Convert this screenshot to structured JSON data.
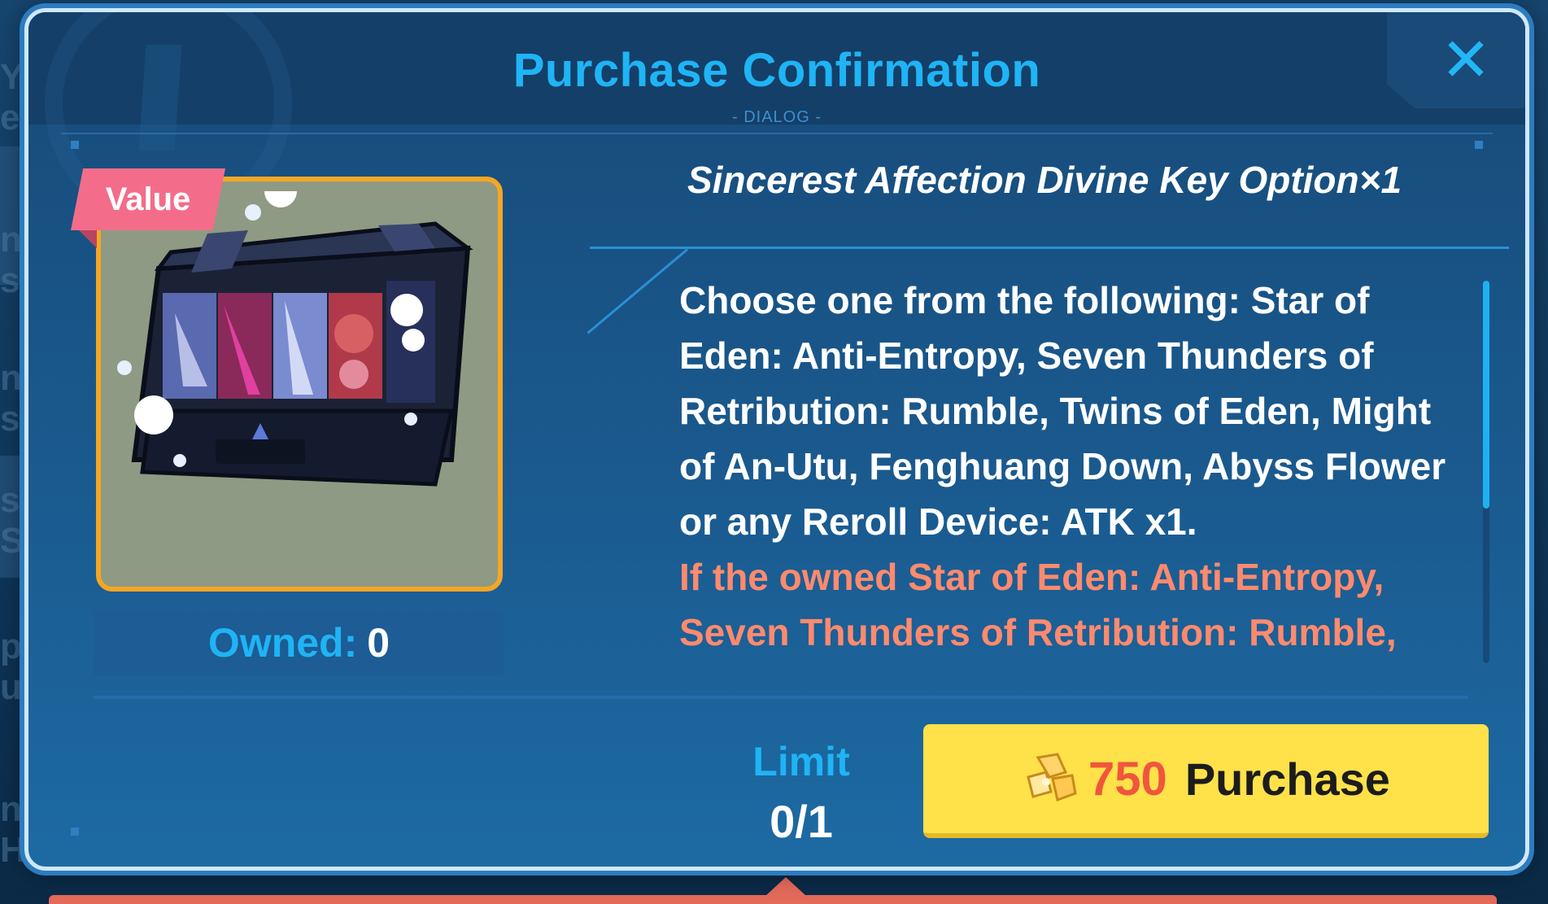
{
  "background_fragments": [
    "Yo",
    "ear",
    "nh",
    "sur",
    "nh",
    "sur",
    "sh",
    "Sh",
    "pe",
    "us",
    "nt",
    "Ho"
  ],
  "dialog": {
    "title": "Purchase Confirmation",
    "subtitle": "- DIALOG -",
    "close_icon": "close-icon"
  },
  "item": {
    "tag": "Value",
    "image_icon": "treasure-chest-icon",
    "owned_label": "Owned:",
    "owned_value": "0",
    "name": "Sincerest Affection Divine Key Option×1",
    "description": "Choose one from the following: Star of Eden: Anti-Entropy, Seven Thunders of Retribution: Rumble, Twins of Eden, Might of An-Utu, Fenghuang Down, Abyss Flower or any Reroll Device: ATK x1.",
    "warning": "If the owned Star of Eden: Anti-Entropy, Seven Thunders of Retribution: Rumble,"
  },
  "limit": {
    "label": "Limit",
    "value": "0/1"
  },
  "purchase": {
    "currency_icon": "crystal-currency-icon",
    "price": "750",
    "label": "Purchase"
  },
  "colors": {
    "title": "#1fb4f5",
    "price": "#f0563c",
    "button": "#ffe14a",
    "warning": "#ff8a6e",
    "tag": "#f36d8a",
    "card_border": "#f5a623"
  }
}
